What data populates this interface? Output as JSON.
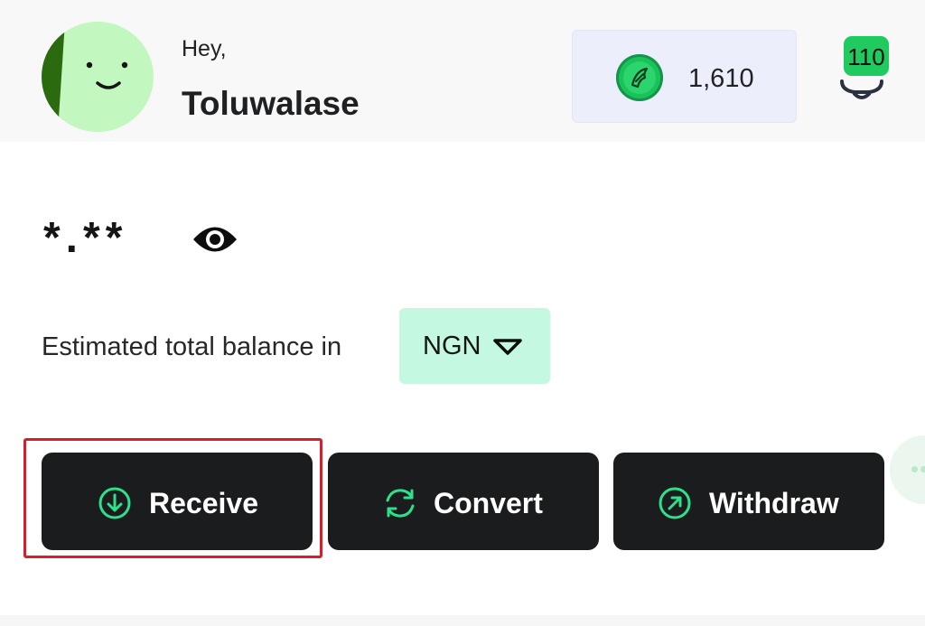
{
  "header": {
    "greeting": "Hey,",
    "username": "Toluwalase",
    "avatar_icon": "smiley-avatar-icon",
    "points": {
      "value": "1,610",
      "icon": "coin-icon"
    },
    "notifications": {
      "count": "110",
      "icon": "bell-icon"
    }
  },
  "balance": {
    "masked_value": "*.**",
    "toggle_icon": "eye-icon",
    "label": "Estimated total balance in",
    "currency": "NGN",
    "currency_icon": "caret-down-icon"
  },
  "actions": [
    {
      "label": "Receive",
      "icon": "arrow-down-circle-icon"
    },
    {
      "label": "Convert",
      "icon": "refresh-icon"
    },
    {
      "label": "Withdraw",
      "icon": "arrow-up-right-circle-icon"
    }
  ],
  "colors": {
    "accent_green": "#1fcb5f",
    "button_dark": "#1b1c1e",
    "currency_bg": "#c5f8e0",
    "points_bg": "#eceefc",
    "highlight": "#d81e2a"
  }
}
